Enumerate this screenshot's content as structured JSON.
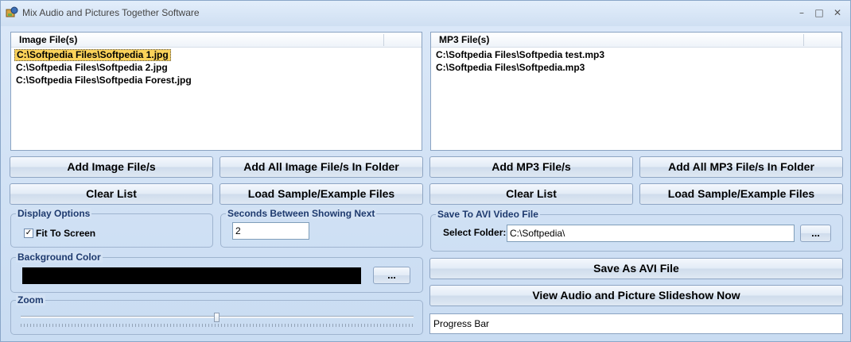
{
  "window": {
    "title": "Mix Audio and Pictures Together Software",
    "minimize_glyph": "–",
    "maximize_glyph": "□",
    "close_glyph": "✕"
  },
  "image_list": {
    "header": "Image File(s)",
    "items": [
      "C:\\Softpedia Files\\Softpedia 1.jpg",
      "C:\\Softpedia Files\\Softpedia 2.jpg",
      "C:\\Softpedia Files\\Softpedia Forest.jpg"
    ],
    "selected_index": 0
  },
  "mp3_list": {
    "header": "MP3 File(s)",
    "items": [
      "C:\\Softpedia Files\\Softpedia test.mp3",
      "C:\\Softpedia Files\\Softpedia.mp3"
    ]
  },
  "buttons": {
    "add_image": "Add Image File/s",
    "add_all_image": "Add All Image File/s In Folder",
    "add_mp3": "Add MP3 File/s",
    "add_all_mp3": "Add All MP3 File/s In Folder",
    "clear_images": "Clear List",
    "load_sample_images": "Load Sample/Example Files",
    "clear_mp3": "Clear List",
    "load_sample_mp3": "Load Sample/Example Files",
    "browse_folder": "...",
    "browse_color": "...",
    "save_avi": "Save As AVI File",
    "view_slideshow": "View Audio and Picture Slideshow Now"
  },
  "display_options": {
    "label": "Display Options",
    "fit_to_screen_label": "Fit To Screen",
    "fit_to_screen_checked": true,
    "check_glyph": "✓"
  },
  "seconds": {
    "label": "Seconds Between Showing Next",
    "value": "2"
  },
  "avi": {
    "label": "Save To AVI Video File",
    "folder_label": "Select Folder:",
    "folder_value": "C:\\Softpedia\\"
  },
  "background": {
    "label": "Background Color",
    "color": "#000000"
  },
  "zoom": {
    "label": "Zoom",
    "level": 0.5
  },
  "progress": {
    "label": "Progress Bar"
  }
}
